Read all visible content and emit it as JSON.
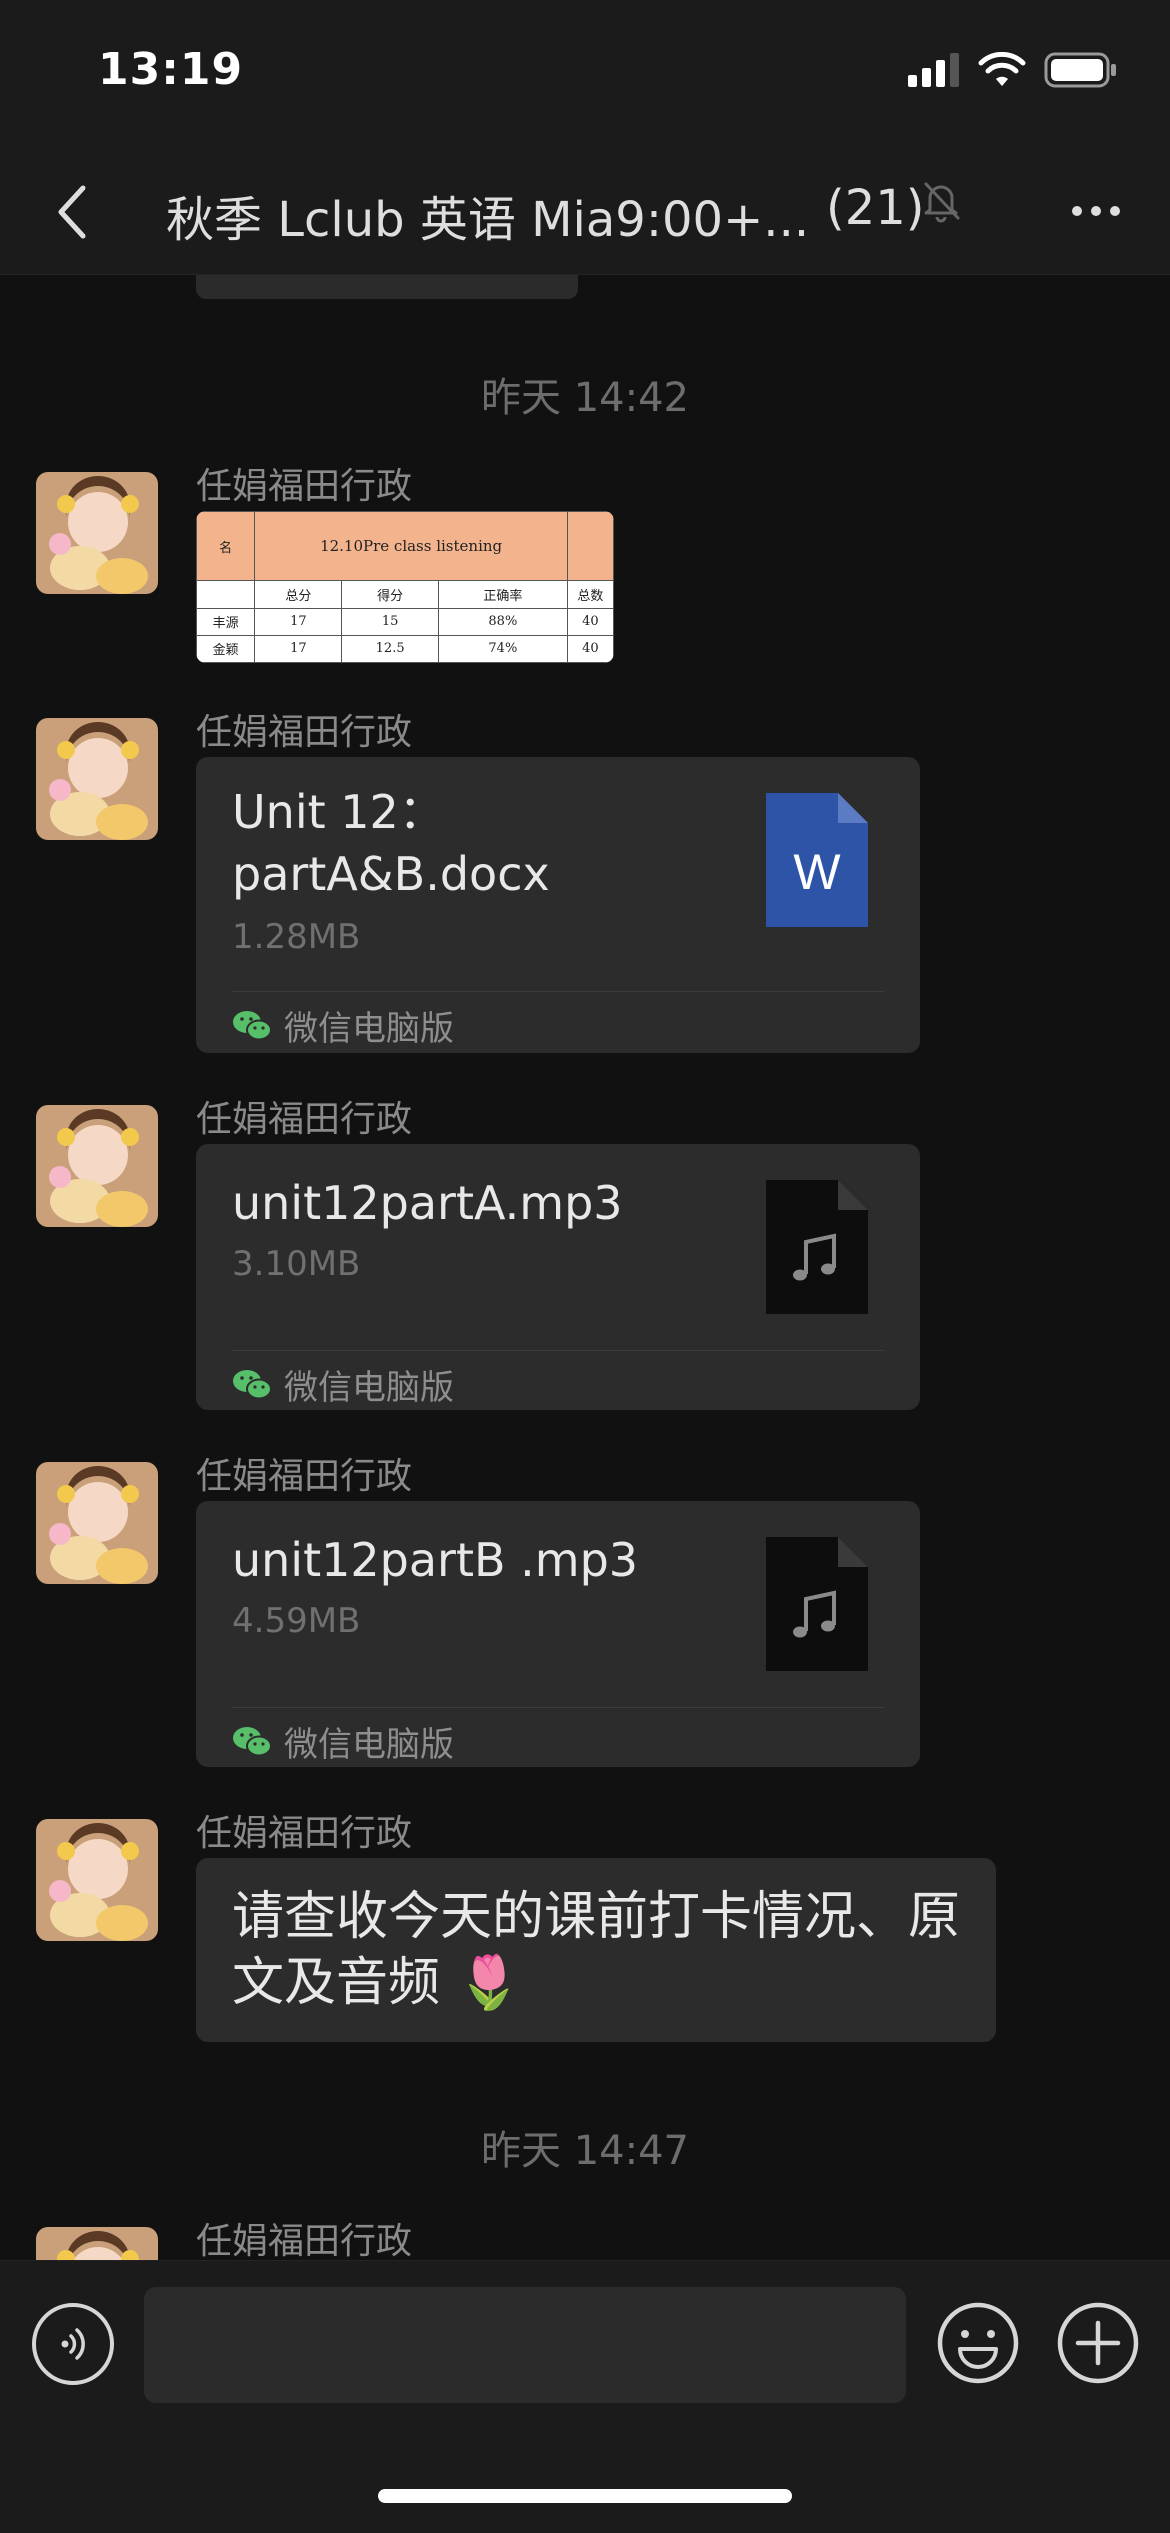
{
  "status_bar": {
    "time": "13:19"
  },
  "header": {
    "title": "秋季 Lclub 英语 Mia9:00+...",
    "member_count": "(21)",
    "muted_icon": "bell-muted-icon",
    "more_icon": "more-dots-icon",
    "back_icon": "chevron-left-icon"
  },
  "messages": {
    "ts1": "昨天 14:42",
    "ts2": "昨天 14:47",
    "sender": "任娟福田行政",
    "m1_image": {
      "title": "12.10Pre class listening",
      "headers": [
        "名",
        "总分",
        "得分",
        "正确率",
        "总数"
      ],
      "row1": [
        "丰源",
        "17",
        "15",
        "88%",
        "40"
      ],
      "row2": [
        "金颖",
        "17",
        "12.5",
        "74%",
        "40"
      ]
    },
    "m2": {
      "name": "Unit 12：partA&B.docx",
      "size": "1.28MB",
      "source": "微信电脑版",
      "icon": "word-file-icon",
      "icon_letter": "W"
    },
    "m3": {
      "name": "unit12partA.mp3",
      "size": "3.10MB",
      "source": "微信电脑版",
      "icon": "audio-file-icon"
    },
    "m4": {
      "name": "unit12partB .mp3",
      "size": "4.59MB",
      "source": "微信电脑版",
      "icon": "audio-file-icon"
    },
    "m5": {
      "text": "请查收今天的课前打卡情况、原文及音频 🌷"
    }
  },
  "input_bar": {
    "voice_icon": "voice-icon",
    "emoji_icon": "emoji-icon",
    "plus_icon": "plus-icon",
    "input_value": ""
  },
  "colors": {
    "background": "#111111",
    "bar": "#1b1b1b",
    "bubble": "#2c2c2c",
    "word_blue": "#2e54a8",
    "wechat_green": "#57be6a",
    "thumb_header": "#f2b38d"
  }
}
